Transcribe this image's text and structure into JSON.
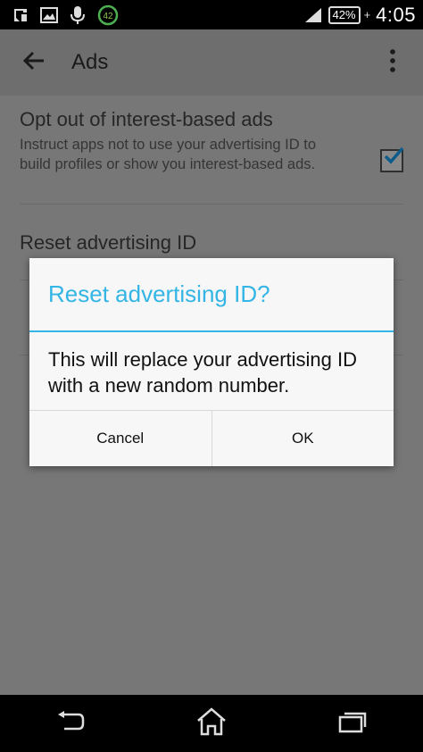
{
  "status_bar": {
    "notification_badge": "42",
    "battery_percent": "42%",
    "battery_plus": "+",
    "time": "4:05",
    "icons": [
      "settings-notification-icon",
      "image-icon",
      "microphone-icon",
      "download-progress-icon",
      "signal-icon",
      "battery-icon"
    ]
  },
  "app_bar": {
    "title": "Ads",
    "back_icon": "arrow-left-icon",
    "overflow_icon": "more-vert-icon"
  },
  "preferences": [
    {
      "title": "Opt out of interest-based ads",
      "summary": "Instruct apps not to use your advertising ID to build profiles or show you interest-based ads.",
      "checked": true
    },
    {
      "title": "Reset advertising ID"
    }
  ],
  "dialog": {
    "title": "Reset advertising ID?",
    "message": "This will replace your advertising ID with a new random number.",
    "cancel_label": "Cancel",
    "ok_label": "OK",
    "accent_color": "#33b5e5"
  },
  "nav_bar": {
    "icons": [
      "back-icon",
      "home-icon",
      "recent-apps-icon"
    ]
  }
}
